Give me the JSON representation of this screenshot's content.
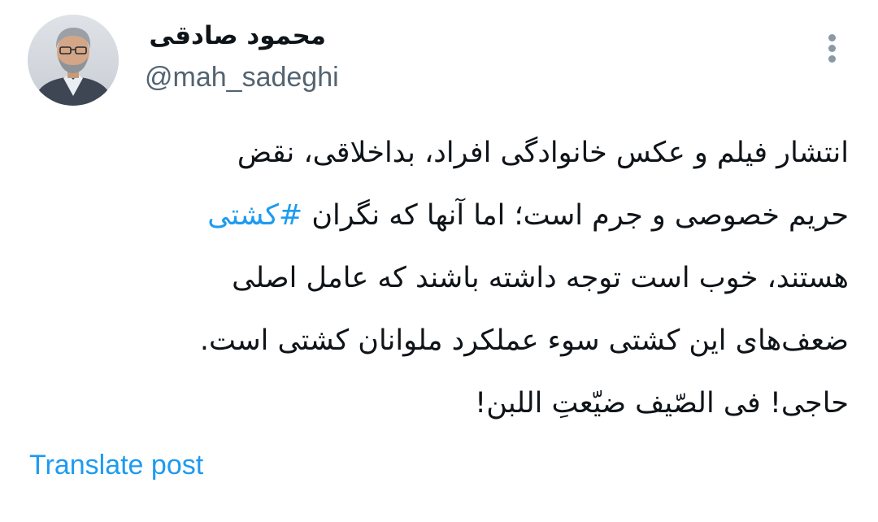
{
  "author": {
    "display_name": "محمود صادقی",
    "handle": "@mah_sadeghi"
  },
  "tweet": {
    "line1": "انتشار فیلم و عکس خانوادگی افراد، بداخلاقی، نقض",
    "line2_text": "حریم خصوصی و جرم است؛ اما آنها که نگران",
    "line2_hashtag": "#کشتی",
    "line3": "هستند، خوب است توجه داشته باشند که عامل اصلی",
    "line4": "ضعف‌های این کشتی سوء عملکرد ملوانان کشتی است.",
    "line5": "حاجی!  فی الصّیف ضیّعتِ اللبن!"
  },
  "actions": {
    "translate_label": "Translate post",
    "more_icon": "more-vertical-icon"
  },
  "colors": {
    "link": "#1d9bf0",
    "secondary_text": "#536471",
    "primary_text": "#0f1419",
    "icon_gray": "#8b98a5"
  }
}
